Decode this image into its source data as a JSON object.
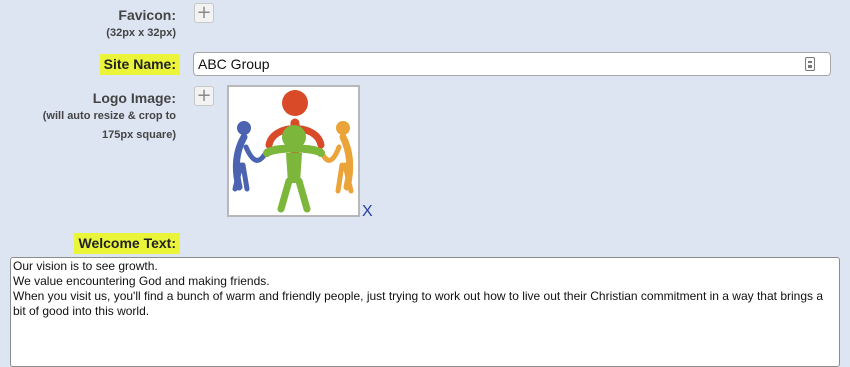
{
  "favicon": {
    "label": "Favicon:",
    "hint": "(32px x 32px)",
    "add_icon": "plus-icon"
  },
  "site_name": {
    "label": "Site Name:",
    "value": "ABC Group",
    "field_icon": "contact-card-icon"
  },
  "logo": {
    "label": "Logo Image:",
    "hint_line1": "(will auto resize & crop to",
    "hint_line2": "175px square)",
    "add_icon": "plus-icon",
    "remove_label": "X"
  },
  "welcome": {
    "label": "Welcome Text:",
    "value": "Our vision is to see growth.\nWe value encountering God and making friends.\nWhen you visit us, you'll find a bunch of warm and friendly people, just trying to work out how to live out their Christian commitment in a way that brings a bit of good into this world."
  },
  "colors": {
    "background": "#dde4f2",
    "highlight": "#eaf53a",
    "link": "#2a3ea0"
  }
}
